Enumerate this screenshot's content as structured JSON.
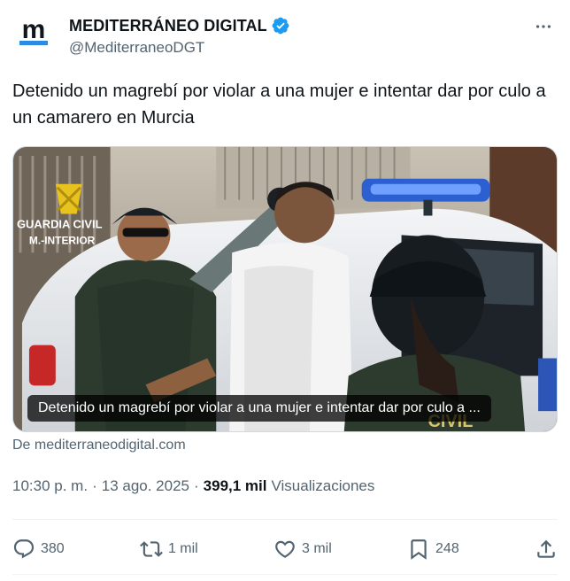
{
  "author": {
    "display_name": "MEDITERRÁNEO DIGITAL",
    "handle": "@MediterraneoDGT",
    "avatar_letter": "m",
    "verified": true
  },
  "tweet": {
    "text": "Detenido un magrebí por violar a una mujer e intentar dar por culo a un camarero en Murcia"
  },
  "media": {
    "caption": "Detenido un magrebí por violar a una mujer e intentar dar por culo a ...",
    "scene_text": {
      "guardia": "GUARDIA CIVIL",
      "interior": "M.-INTERIOR",
      "vest": "CIVIL"
    },
    "source": "De mediterraneodigital.com"
  },
  "meta": {
    "time": "10:30 p. m.",
    "separator": "·",
    "date": "13 ago. 2025",
    "views_count": "399,1 mil",
    "views_label": "Visualizaciones"
  },
  "actions": {
    "replies": "380",
    "reposts": "1 mil",
    "likes": "3 mil",
    "bookmarks": "248"
  },
  "colors": {
    "accent": "#1d9bf0",
    "text": "#0f1419",
    "muted": "#536471",
    "brand": "#0f1419"
  }
}
